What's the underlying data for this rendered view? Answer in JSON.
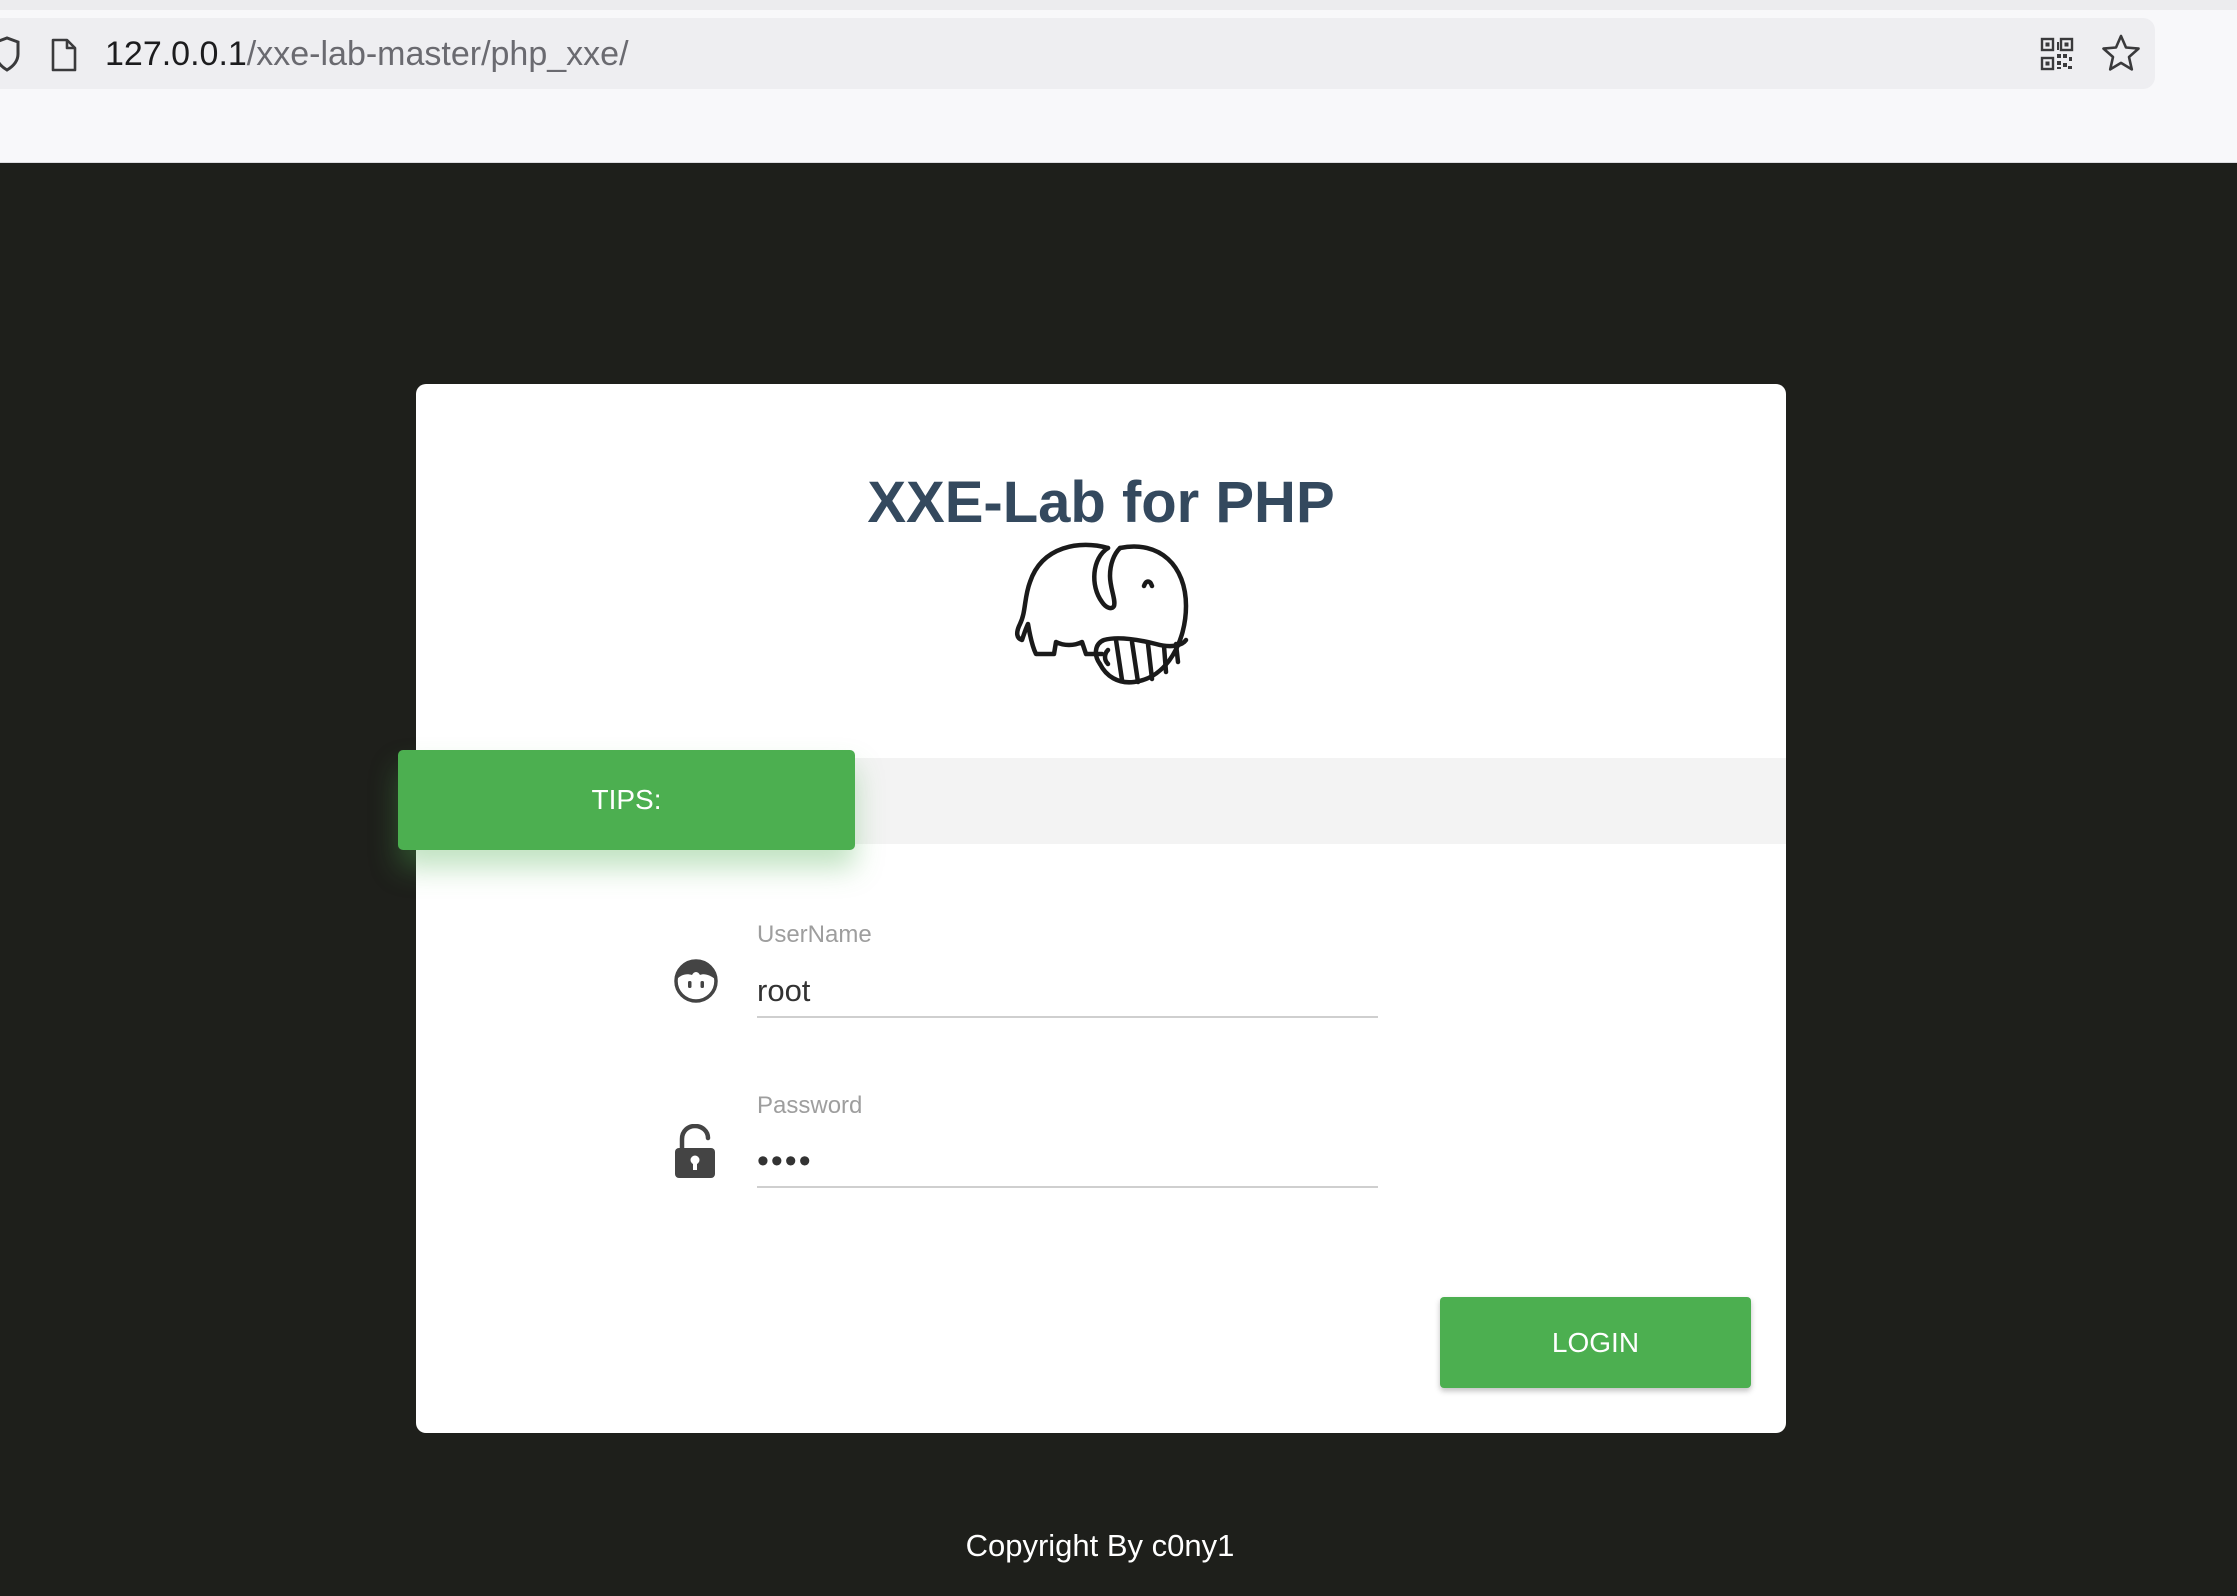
{
  "browser": {
    "url_host": "127.0.0.1",
    "url_path": "/xxe-lab-master/php_xxe/"
  },
  "page": {
    "title": "XXE-Lab for PHP",
    "tips_label": "TIPS:",
    "username": {
      "label": "UserName",
      "value": "root"
    },
    "password": {
      "label": "Password",
      "value": "root"
    },
    "login_label": "LOGIN",
    "footer": "Copyright By c0ny1"
  },
  "colors": {
    "background": "#1e1f1b",
    "accent_green": "#4caf50",
    "title": "#34495e"
  },
  "icons": [
    "shield-icon",
    "page-icon",
    "qr-code-icon",
    "star-icon",
    "elephant-logo",
    "user-face-icon",
    "lock-icon"
  ]
}
